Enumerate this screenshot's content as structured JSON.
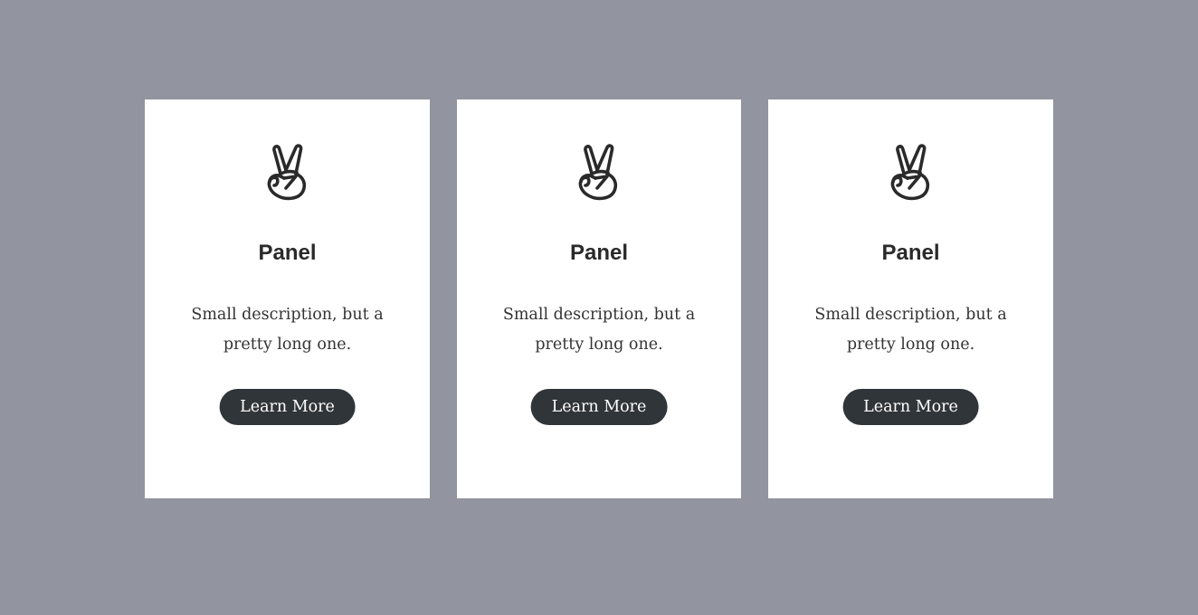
{
  "colors": {
    "background": "#9295a0",
    "panel": "#ffffff",
    "button": "#30353a",
    "button_text": "#ffffff",
    "title": "#2a2a2a",
    "description": "#333333",
    "icon": "#2a2a2a"
  },
  "panels": [
    {
      "icon": "peace-hand-icon",
      "title": "Panel",
      "description": "Small description, but a pretty long one.",
      "button_label": "Learn More"
    },
    {
      "icon": "peace-hand-icon",
      "title": "Panel",
      "description": "Small description, but a pretty long one.",
      "button_label": "Learn More"
    },
    {
      "icon": "peace-hand-icon",
      "title": "Panel",
      "description": "Small description, but a pretty long one.",
      "button_label": "Learn More"
    }
  ]
}
